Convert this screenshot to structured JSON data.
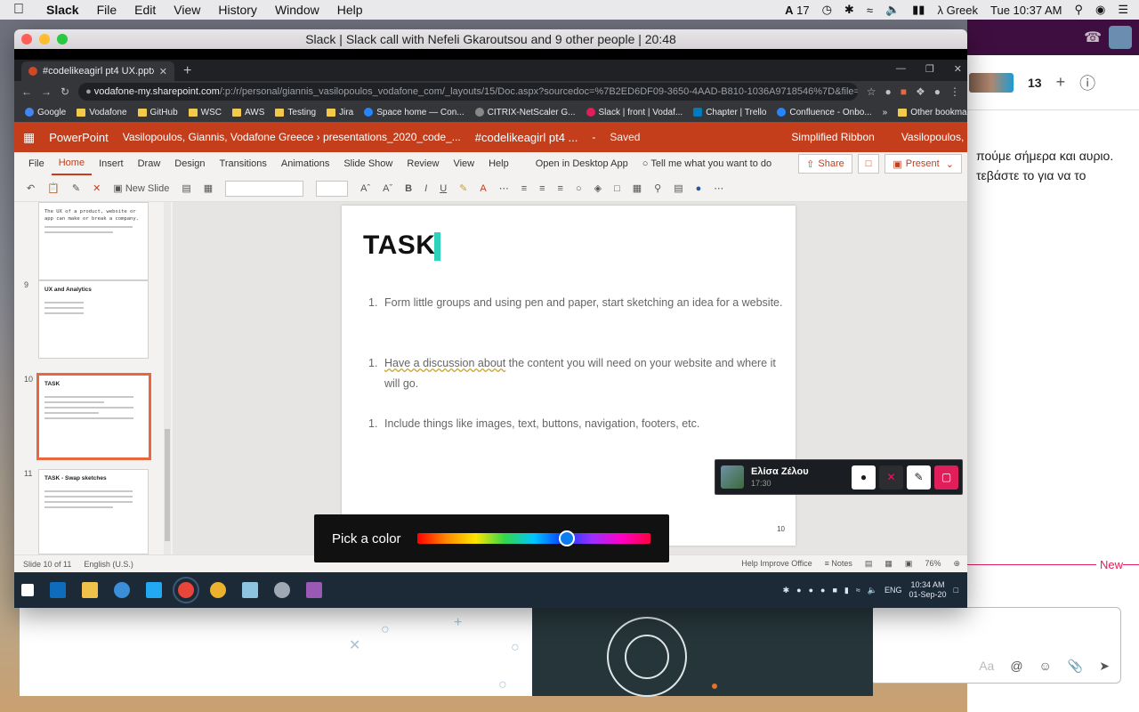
{
  "menubar": {
    "apple": "",
    "items": [
      "Slack",
      "File",
      "Edit",
      "View",
      "History",
      "Window",
      "Help"
    ],
    "status": {
      "notifications": "17",
      "input_source": "Greek",
      "clock": "Tue 10:37 AM"
    }
  },
  "slack_bg": {
    "member_count": "13",
    "message_line1": "πούμε σήμερα και αυριο.",
    "message_line2": "τεβάστε το για να το",
    "new_label": "New",
    "composer_placeholder": "Aa"
  },
  "call_window": {
    "title": "Slack | Slack call with Nefeli Gkaroutsou and 9 other people | 20:48"
  },
  "chrome": {
    "tab_title": "#codelikeagirl pt4 UX.pptx",
    "url_host": "vodafone-my.sharepoint.com",
    "url_path": "/:p:/r/personal/giannis_vasilopoulos_vodafone_com/_layouts/15/Doc.aspx?sourcedoc=%7B2ED6DF09-3650-4AAD-B810-1036A9718546%7D&file=%23codelikea...",
    "bookmarks": [
      "Google",
      "Vodafone",
      "GitHub",
      "WSC",
      "AWS",
      "Testing",
      "Jira",
      "Space home — Con...",
      "CITRIX-NetScaler G...",
      "Slack | front | Vodaf...",
      "Chapter | Trello",
      "Confluence - Onbo..."
    ],
    "more": "»",
    "other_bookmarks": "Other bookmarks"
  },
  "ppt": {
    "app": "PowerPoint",
    "breadcrumb": "Vasilopoulos, Giannis, Vodafone Greece › presentations_2020_code_...",
    "file": "#codelikeagirl pt4 ...",
    "saved": "Saved",
    "simplified": "Simplified Ribbon",
    "user": "Vasilopoulos, Giannis, Vodafone Greece",
    "tabs": [
      "File",
      "Home",
      "Insert",
      "Draw",
      "Design",
      "Transitions",
      "Animations",
      "Slide Show",
      "Review",
      "View",
      "Help"
    ],
    "open_desktop": "Open in Desktop App",
    "tell_me": "Tell me what you want to do",
    "share": "Share",
    "present": "Present",
    "new_slide": "New Slide",
    "thumbs": [
      {
        "num": "",
        "title": "",
        "text": "The UX of a product, website or app can make or break a company."
      },
      {
        "num": "9",
        "title": "UX and Analytics",
        "text": ""
      },
      {
        "num": "10",
        "title": "TASK",
        "text": ""
      },
      {
        "num": "11",
        "title": "TASK - Swap sketches",
        "text": ""
      }
    ],
    "slide": {
      "title": "TASK",
      "items": [
        {
          "n": "1.",
          "text": "Form little groups and using pen and paper, start sketching an idea for a website."
        },
        {
          "n": "1.",
          "text_a": "Have a discussion about",
          "text_b": " the content you will need on your website and where it will go."
        },
        {
          "n": "1.",
          "text": "Include things like images, text, buttons, navigation, footers, etc."
        }
      ],
      "number": "10"
    },
    "status": {
      "slide": "Slide 10 of 11",
      "lang": "English (U.S.)",
      "help": "Help Improve Office",
      "notes": "Notes",
      "zoom": "76%"
    }
  },
  "color_picker": {
    "label": "Pick a color",
    "value": 0.64
  },
  "taskbar": {
    "lang": "ENG",
    "time": "10:34 AM",
    "date": "01-Sep-20"
  },
  "callee": {
    "name": "Ελίσα Ζέλου",
    "time": "17:30"
  }
}
